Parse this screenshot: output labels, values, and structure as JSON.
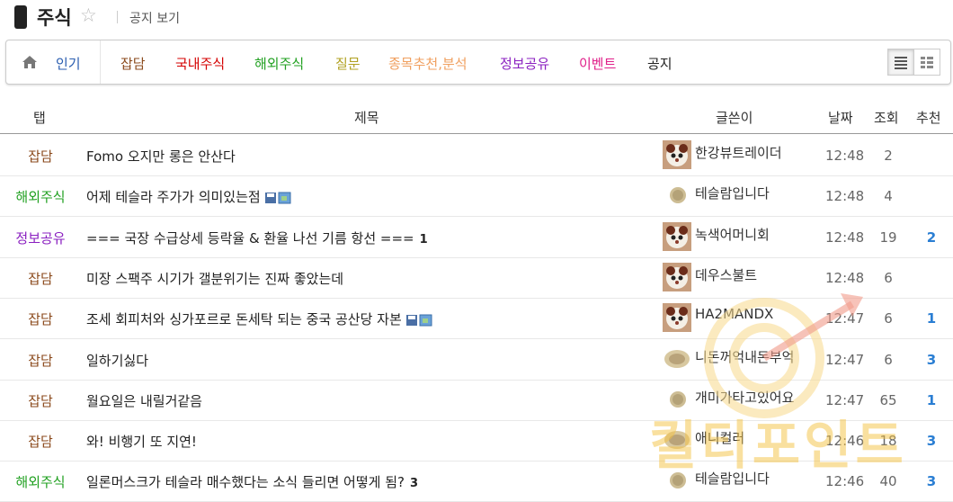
{
  "header": {
    "board_title": "주식",
    "notice_link": "공지 보기"
  },
  "tabs": [
    {
      "label": "인기",
      "color": "#2a5db0"
    },
    {
      "label": "잡담",
      "color": "#8b4a1c"
    },
    {
      "label": "국내주식",
      "color": "#d40000"
    },
    {
      "label": "해외주식",
      "color": "#20a020"
    },
    {
      "label": "질문",
      "color": "#b0a020"
    },
    {
      "label": "종목추천,분석",
      "color": "#f0a060"
    },
    {
      "label": "정보공유",
      "color": "#8a1fc0"
    },
    {
      "label": "이벤트",
      "color": "#e0208a"
    },
    {
      "label": "공지",
      "color": "#222222"
    }
  ],
  "columns": {
    "tab": "탭",
    "title": "제목",
    "author": "글쓴이",
    "date": "날짜",
    "views": "조회",
    "recommend": "추천"
  },
  "rows": [
    {
      "cat": "잡담",
      "cat_color": "#8b4a1c",
      "title": "Fomo 오지만 롱은 안산다",
      "comments": "",
      "files": false,
      "avatar": "large",
      "author": "한강뷰트레이더",
      "time": "12:48",
      "views": "2",
      "rec": ""
    },
    {
      "cat": "해외주식",
      "cat_color": "#20a020",
      "title": "어제 테슬라 주가가 의미있는점",
      "comments": "",
      "files": true,
      "avatar": "small",
      "author": "테슬람입니다",
      "time": "12:48",
      "views": "4",
      "rec": ""
    },
    {
      "cat": "정보공유",
      "cat_color": "#8a1fc0",
      "title": "=== 국장 수급상세 등락율 & 환율 나선 기름 항선 ===",
      "comments": "1",
      "files": false,
      "avatar": "large",
      "author": "녹색어머니회",
      "time": "12:48",
      "views": "19",
      "rec": "2"
    },
    {
      "cat": "잡담",
      "cat_color": "#8b4a1c",
      "title": "미장 스팩주 시기가 갤분위기는 진짜 좋았는데",
      "comments": "",
      "files": false,
      "avatar": "large",
      "author": "데우스불트",
      "time": "12:48",
      "views": "6",
      "rec": ""
    },
    {
      "cat": "잡담",
      "cat_color": "#8b4a1c",
      "title": "조세 회피처와 싱가포르로 돈세탁 되는 중국 공산당 자본",
      "comments": "",
      "files": true,
      "avatar": "large",
      "author": "HA2MANDX",
      "time": "12:47",
      "views": "6",
      "rec": "1"
    },
    {
      "cat": "잡담",
      "cat_color": "#8b4a1c",
      "title": "일하기싫다",
      "comments": "",
      "files": false,
      "avatar": "medium",
      "author": "니돈꺼억내돈부억",
      "time": "12:47",
      "views": "6",
      "rec": "3"
    },
    {
      "cat": "잡담",
      "cat_color": "#8b4a1c",
      "title": "월요일은 내릴거같음",
      "comments": "",
      "files": false,
      "avatar": "small",
      "author": "개미가타고있어요",
      "time": "12:47",
      "views": "65",
      "rec": "1"
    },
    {
      "cat": "잡담",
      "cat_color": "#8b4a1c",
      "title": "와! 비행기 또 지연!",
      "comments": "",
      "files": false,
      "avatar": "medium",
      "author": "애니컬러",
      "time": "12:46",
      "views": "18",
      "rec": "3"
    },
    {
      "cat": "해외주식",
      "cat_color": "#20a020",
      "title": "일론머스크가 테슬라 매수했다는 소식 들리면 어떻게 됨?",
      "comments": "3",
      "files": false,
      "avatar": "small",
      "author": "테슬람입니다",
      "time": "12:46",
      "views": "40",
      "rec": "3"
    }
  ],
  "watermark": {
    "text": "킬티포인트",
    "color": "#f5c242"
  }
}
